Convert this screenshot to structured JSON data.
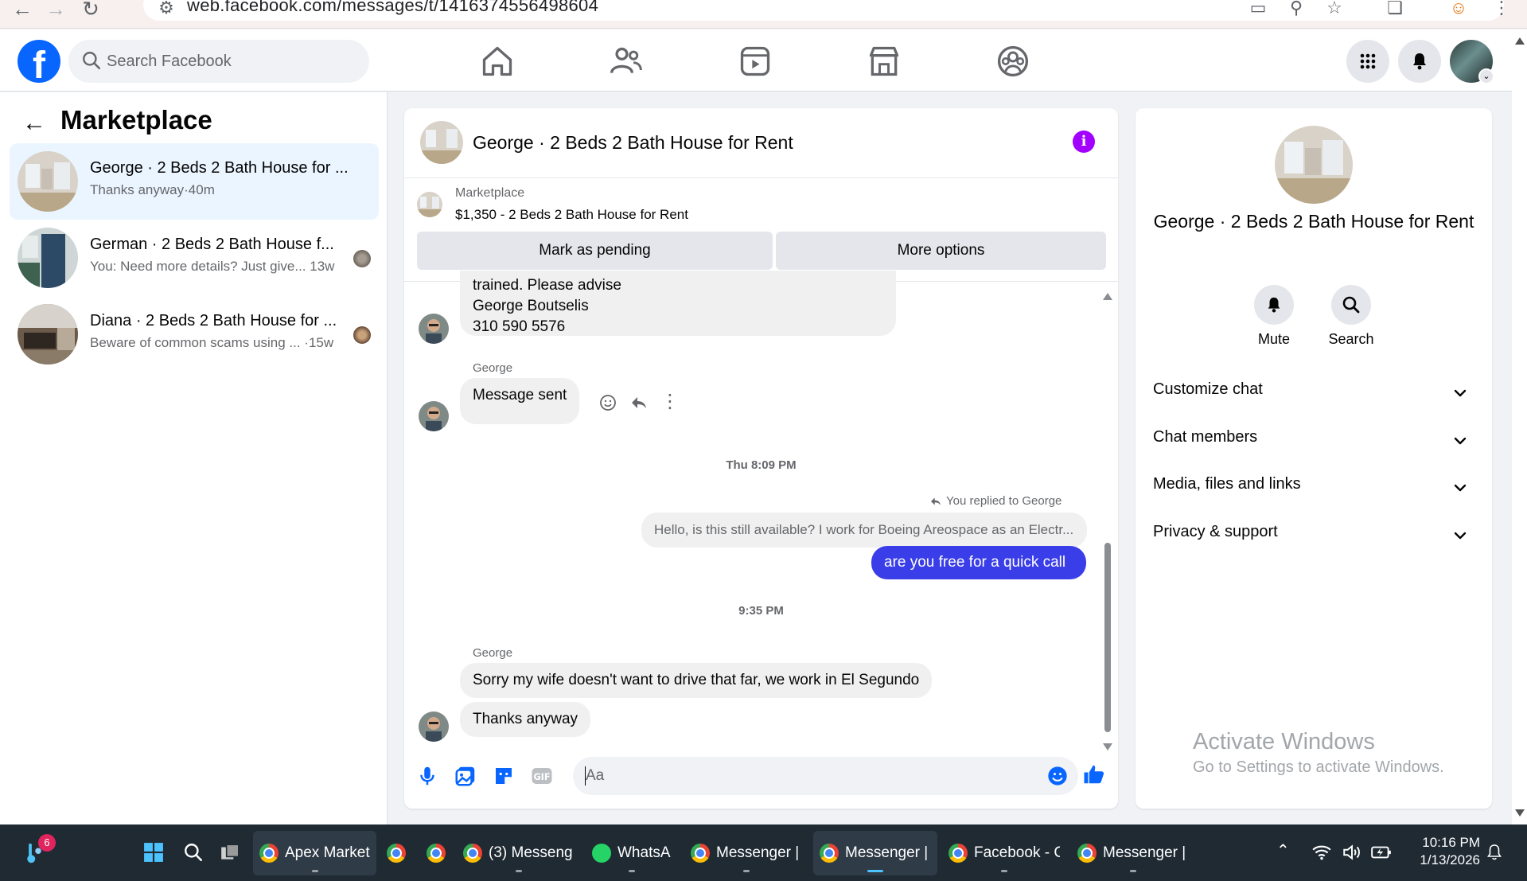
{
  "browser": {
    "url": "web.facebook.com/messages/t/1416374556498604"
  },
  "header": {
    "search_placeholder": "Search Facebook"
  },
  "sidebar": {
    "title": "Marketplace",
    "conversations": [
      {
        "name": "George · 2 Beds 2 Bath House for ...",
        "preview": "Thanks anyway",
        "time": "·40m"
      },
      {
        "name": "German · 2 Beds 2 Bath House f...",
        "preview": "You: Need more details? Just give...",
        "time": "13w"
      },
      {
        "name": "Diana · 2 Beds 2 Bath House for ...",
        "preview": "Beware of common scams using ...",
        "time": "·15w"
      }
    ]
  },
  "chat": {
    "title": "George · 2 Beds 2 Bath House for Rent",
    "marketplace_label": "Marketplace",
    "listing": "$1,350 - 2 Beds 2 Bath House for Rent",
    "mark_pending": "Mark as pending",
    "more_options": "More options",
    "msg1_line1": "trained. Please advise",
    "msg1_line2": "George Boutselis",
    "msg1_line3": "310 590 5576",
    "sender1": "George",
    "msg2": "Message sent",
    "time1": "Thu 8:09 PM",
    "replied_note": "You replied to George",
    "quoted": "Hello, is this still available? I work for Boeing Areospace as an Electr...",
    "outgoing": "are you free for a quick call",
    "time2": "9:35 PM",
    "sender2": "George",
    "msg3": "Sorry my wife doesn't want to drive that far, we work in El Segundo",
    "msg4": "Thanks anyway",
    "composer_placeholder": "Aa"
  },
  "info_panel": {
    "name": "George · 2 Beds 2 Bath House for Rent",
    "mute": "Mute",
    "search": "Search",
    "rows": [
      "Customize chat",
      "Chat members",
      "Media, files and links",
      "Privacy & support"
    ]
  },
  "watermark": {
    "line1": "Activate Windows",
    "line2": "Go to Settings to activate Windows."
  },
  "taskbar": {
    "badge": "6",
    "items": [
      "Apex Market",
      "(3) Messeng",
      "WhatsA",
      "Messenger |",
      "Messenger |",
      "Facebook - C",
      "Messenger |"
    ],
    "time": "10:16 PM",
    "date": "1/13/2026"
  },
  "colors": {
    "brand_blue": "#0866ff",
    "outgoing_bubble": "#3a3ee8",
    "info_purple": "#a200ff"
  }
}
